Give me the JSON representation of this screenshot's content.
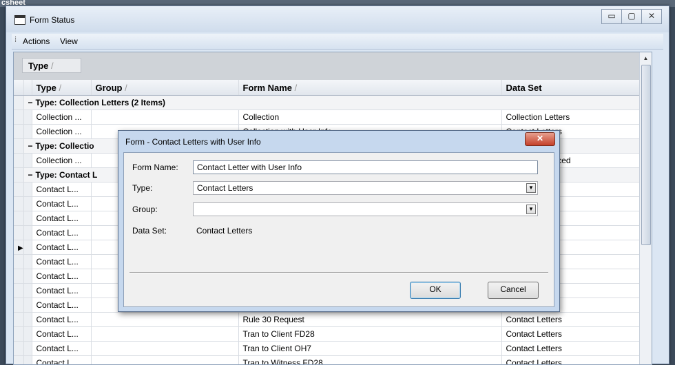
{
  "background": {
    "label": "csheet"
  },
  "window": {
    "title": "Form Status",
    "buttons": {
      "minimize": "▭",
      "restore": "▢",
      "close": "✕"
    }
  },
  "menu": {
    "items": [
      {
        "label": "Actions",
        "mnemonic": "A"
      },
      {
        "label": "View",
        "mnemonic": "V"
      }
    ]
  },
  "groupbox": {
    "chip": "Type"
  },
  "grid": {
    "columns": [
      "Type",
      "Group",
      "Form Name",
      "Data Set"
    ],
    "group_headers": [
      "Type: Collection Letters (2 Items)",
      "Type: Collectio",
      "Type: Contact L"
    ],
    "rows_collection": [
      {
        "type": "Collection ...",
        "group": "",
        "form": "Collection",
        "dataset": "Collection Letters"
      },
      {
        "type": "Collection ...",
        "group": "",
        "form": "Collection with User Info",
        "dataset": "Contact Letters"
      }
    ],
    "rows_collection2": [
      {
        "type": "Collection ...",
        "group": "",
        "form": "",
        "dataset": "Letters Enhanced"
      }
    ],
    "rows_contact": [
      {
        "type": "Contact L...",
        "group": "",
        "form": "",
        "dataset": "etters"
      },
      {
        "type": "Contact L...",
        "group": "",
        "form": "",
        "dataset": "etters"
      },
      {
        "type": "Contact L...",
        "group": "",
        "form": "",
        "dataset": "etters"
      },
      {
        "type": "Contact L...",
        "group": "",
        "form": "",
        "dataset": "etters"
      },
      {
        "type": "Contact L...",
        "group": "",
        "form": "",
        "dataset": "etters"
      },
      {
        "type": "Contact L...",
        "group": "",
        "form": "",
        "dataset": "etters"
      },
      {
        "type": "Contact L...",
        "group": "",
        "form": "",
        "dataset": "etters"
      },
      {
        "type": "Contact L...",
        "group": "",
        "form": "",
        "dataset": "etters"
      },
      {
        "type": "Contact L...",
        "group": "",
        "form": "",
        "dataset": "etters"
      },
      {
        "type": "Contact L...",
        "group": "",
        "form": "Rule 30 Request",
        "dataset": "Contact Letters"
      },
      {
        "type": "Contact L...",
        "group": "",
        "form": "Tran to Client FD28",
        "dataset": "Contact Letters"
      },
      {
        "type": "Contact L...",
        "group": "",
        "form": "Tran to Client OH7",
        "dataset": "Contact Letters"
      },
      {
        "type": "Contact L...",
        "group": "",
        "form": "Tran to Witness FD28",
        "dataset": "Contact Letters"
      }
    ],
    "current_row_indicator": "▶"
  },
  "dialog": {
    "title": "Form - Contact Letters with User Info",
    "close": "✕",
    "form_name_label": "Form Name:",
    "form_name_value": "Contact Letter with User Info",
    "type_label": "Type:",
    "type_value": "Contact Letters",
    "group_label": "Group:",
    "group_value": "",
    "dataset_label": "Data Set:",
    "dataset_value": "Contact Letters",
    "ok_label": "OK",
    "cancel_label": "Cancel"
  }
}
